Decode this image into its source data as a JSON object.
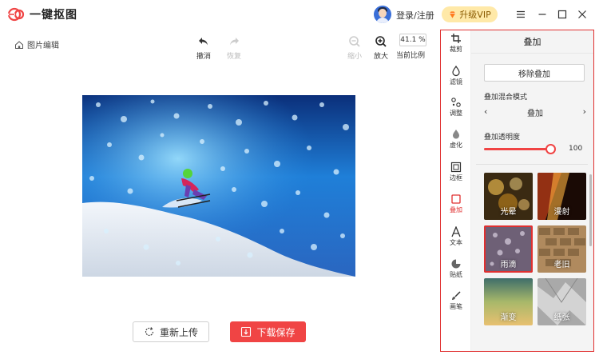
{
  "app": {
    "name": "一键抠图"
  },
  "header": {
    "login_label": "登录/注册",
    "vip_label": "升级VIP"
  },
  "toolbar": {
    "breadcrumb": "图片编辑",
    "undo_label": "撤消",
    "redo_label": "恢复",
    "zoom_out_label": "缩小",
    "zoom_in_label": "放大",
    "zoom_value": "41.1 %",
    "zoom_ratio_label": "当前比例"
  },
  "actions": {
    "reupload_label": "重新上传",
    "download_label": "下载保存"
  },
  "rail": {
    "items": [
      {
        "label": "裁剪",
        "icon": "crop-icon"
      },
      {
        "label": "滤镜",
        "icon": "filter-icon"
      },
      {
        "label": "调整",
        "icon": "adjust-icon"
      },
      {
        "label": "虚化",
        "icon": "blur-icon"
      },
      {
        "label": "边框",
        "icon": "frame-icon"
      },
      {
        "label": "叠加",
        "icon": "overlay-icon"
      },
      {
        "label": "文本",
        "icon": "text-icon"
      },
      {
        "label": "贴纸",
        "icon": "sticker-icon"
      },
      {
        "label": "画笔",
        "icon": "brush-icon"
      }
    ],
    "active": "叠加"
  },
  "overlay_panel": {
    "title": "叠加",
    "remove_label": "移除叠加",
    "blend_mode_label": "叠加混合模式",
    "blend_mode_value": "叠加",
    "opacity_label": "叠加透明度",
    "opacity_value": "100",
    "opacity_fraction": 1.0,
    "thumbnails": [
      {
        "label": "光晕"
      },
      {
        "label": "漫射"
      },
      {
        "label": "雨滴"
      },
      {
        "label": "老旧"
      },
      {
        "label": "渐变"
      },
      {
        "label": "纸张"
      }
    ],
    "selected_thumbnail": "雨滴"
  },
  "colors": {
    "accent": "#f04444",
    "panel_border": "#e03030",
    "vip_bg": "#ffe9a8"
  }
}
